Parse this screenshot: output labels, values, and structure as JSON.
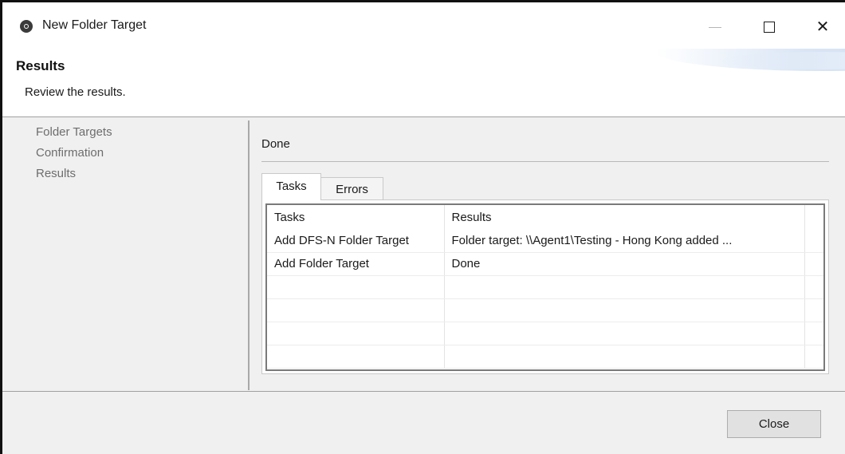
{
  "window": {
    "title": "New Folder Target",
    "icon": "app-logo-icon",
    "controls": {
      "minimize": "minimize-icon",
      "maximize": "maximize-icon",
      "close": "close-icon"
    }
  },
  "header": {
    "title": "Results",
    "subtitle": "Review the results."
  },
  "sidebar": {
    "items": [
      {
        "label": "Folder Targets"
      },
      {
        "label": "Confirmation"
      },
      {
        "label": "Results"
      }
    ]
  },
  "main": {
    "status": "Done",
    "tabs": [
      {
        "label": "Tasks",
        "active": true
      },
      {
        "label": "Errors",
        "active": false
      }
    ],
    "table": {
      "columns": [
        "Tasks",
        "Results"
      ],
      "rows": [
        [
          "Add DFS-N Folder Target",
          "Folder target: \\\\Agent1\\Testing - Hong Kong added ..."
        ],
        [
          "Add Folder Target",
          "Done"
        ]
      ]
    }
  },
  "footer": {
    "close_label": "Close"
  },
  "colors": {
    "dialog_background": "#f0f0f0",
    "header_background": "#ffffff",
    "button_background": "#e1e1e1",
    "nav_text": "#6d6d6d"
  }
}
